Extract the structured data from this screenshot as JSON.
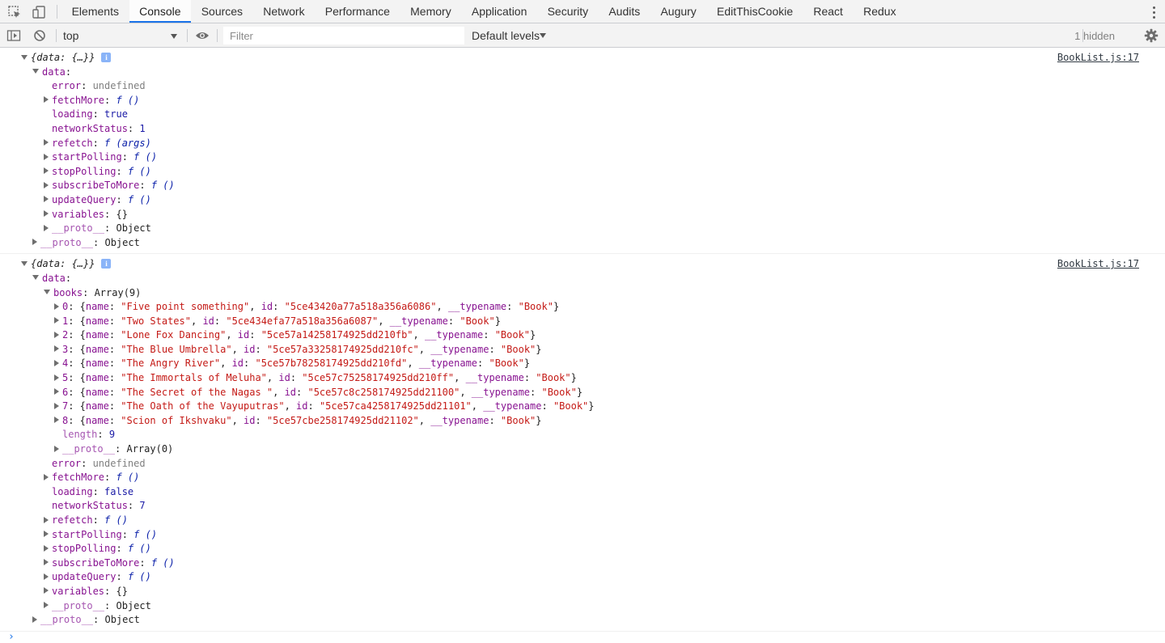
{
  "tabs": [
    "Elements",
    "Console",
    "Sources",
    "Network",
    "Performance",
    "Memory",
    "Application",
    "Security",
    "Audits",
    "Augury",
    "EditThisCookie",
    "React",
    "Redux"
  ],
  "active_tab": "Console",
  "toolbar": {
    "context": "top",
    "filter_placeholder": "Filter",
    "levels": "Default levels",
    "hidden": "1 hidden"
  },
  "console": {
    "source": "BookList.js:17",
    "info_badge": "i",
    "msg1": {
      "summary": "{data: {…}}",
      "data_key": "data",
      "props": [
        {
          "arrow": false,
          "key": "error",
          "val": "undefined",
          "type": "u"
        },
        {
          "arrow": true,
          "key": "fetchMore",
          "val": "f ()",
          "type": "fn"
        },
        {
          "arrow": false,
          "key": "loading",
          "val": "true",
          "type": "n"
        },
        {
          "arrow": false,
          "key": "networkStatus",
          "val": "1",
          "type": "n"
        },
        {
          "arrow": true,
          "key": "refetch",
          "val": "f (args)",
          "type": "fn"
        },
        {
          "arrow": true,
          "key": "startPolling",
          "val": "f ()",
          "type": "fn"
        },
        {
          "arrow": true,
          "key": "stopPolling",
          "val": "f ()",
          "type": "fn"
        },
        {
          "arrow": true,
          "key": "subscribeToMore",
          "val": "f ()",
          "type": "fn"
        },
        {
          "arrow": true,
          "key": "updateQuery",
          "val": "f ()",
          "type": "fn"
        },
        {
          "arrow": true,
          "key": "variables",
          "val": "{}",
          "type": "obj"
        },
        {
          "arrow": true,
          "key": "__proto__",
          "val": "Object",
          "type": "obj",
          "dim": true
        }
      ],
      "outer_proto": {
        "key": "__proto__",
        "val": "Object"
      }
    },
    "msg2": {
      "summary": "{data: {…}}",
      "data_key": "data",
      "books_key": "books",
      "books_val": "Array(9)",
      "books": [
        {
          "index": "0",
          "name": "\"Five point something\"",
          "id": "\"5ce43420a77a518a356a6086\""
        },
        {
          "index": "1",
          "name": "\"Two States\"",
          "id": "\"5ce434efa77a518a356a6087\""
        },
        {
          "index": "2",
          "name": "\"Lone Fox Dancing\"",
          "id": "\"5ce57a14258174925dd210fb\""
        },
        {
          "index": "3",
          "name": "\"The Blue Umbrella\"",
          "id": "\"5ce57a33258174925dd210fc\""
        },
        {
          "index": "4",
          "name": "\"The Angry River\"",
          "id": "\"5ce57b78258174925dd210fd\""
        },
        {
          "index": "5",
          "name": "\"The Immortals of Meluha\"",
          "id": "\"5ce57c75258174925dd210ff\""
        },
        {
          "index": "6",
          "name": "\"The Secret of the Nagas \"",
          "id": "\"5ce57c8c258174925dd21100\""
        },
        {
          "index": "7",
          "name": "\"The Oath of the Vayuputras\"",
          "id": "\"5ce57ca4258174925dd21101\""
        },
        {
          "index": "8",
          "name": "\"Scion of Ikshvaku\"",
          "id": "\"5ce57cbe258174925dd21102\""
        }
      ],
      "typename_val": "\"Book\"",
      "length_key": "length",
      "length_val": "9",
      "array_proto_val": "Array(0)",
      "props": [
        {
          "arrow": false,
          "key": "error",
          "val": "undefined",
          "type": "u"
        },
        {
          "arrow": true,
          "key": "fetchMore",
          "val": "f ()",
          "type": "fn"
        },
        {
          "arrow": false,
          "key": "loading",
          "val": "false",
          "type": "n"
        },
        {
          "arrow": false,
          "key": "networkStatus",
          "val": "7",
          "type": "n"
        },
        {
          "arrow": true,
          "key": "refetch",
          "val": "f ()",
          "type": "fn"
        },
        {
          "arrow": true,
          "key": "startPolling",
          "val": "f ()",
          "type": "fn"
        },
        {
          "arrow": true,
          "key": "stopPolling",
          "val": "f ()",
          "type": "fn"
        },
        {
          "arrow": true,
          "key": "subscribeToMore",
          "val": "f ()",
          "type": "fn"
        },
        {
          "arrow": true,
          "key": "updateQuery",
          "val": "f ()",
          "type": "fn"
        },
        {
          "arrow": true,
          "key": "variables",
          "val": "{}",
          "type": "obj"
        },
        {
          "arrow": true,
          "key": "__proto__",
          "val": "Object",
          "type": "obj",
          "dim": true
        }
      ],
      "outer_proto": {
        "key": "__proto__",
        "val": "Object"
      }
    },
    "prompt": "›"
  },
  "colors": {
    "accent": "#1a73e8",
    "key": "#881391",
    "string": "#c41a16",
    "number": "#1a1aa6"
  },
  "icons": [
    "inspect-element-icon",
    "device-toolbar-icon",
    "sidebar-toggle-icon",
    "clear-console-icon",
    "eye-icon",
    "gear-icon",
    "kebab-menu-icon"
  ]
}
